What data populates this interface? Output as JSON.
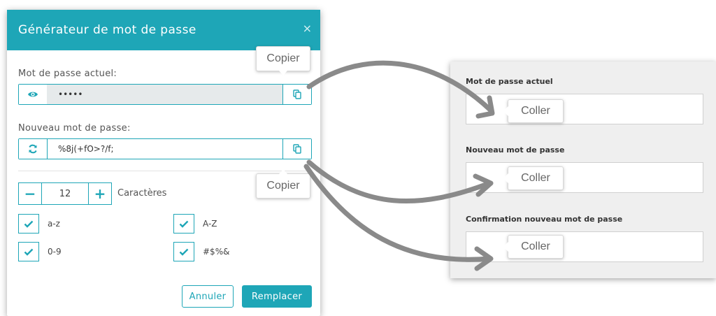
{
  "dialog": {
    "title": "Générateur de mot de passe",
    "close_glyph": "×",
    "current_label": "Mot de passe actuel:",
    "current_value": "•••••",
    "new_label": "Nouveau mot de passe:",
    "new_value": "%8j(+fO>?/f;",
    "length_value": "12",
    "length_minus": "−",
    "length_plus": "+",
    "length_label": "Caractères",
    "checks": [
      {
        "label": "a-z",
        "checked": true
      },
      {
        "label": "A-Z",
        "checked": true
      },
      {
        "label": "0-9",
        "checked": true
      },
      {
        "label": "#$%&",
        "checked": true
      }
    ],
    "cancel_label": "Annuler",
    "replace_label": "Remplacer",
    "accent_color": "#1ea6b7",
    "icons": {
      "reveal": "eye-icon",
      "regenerate": "refresh-icon",
      "copy": "copy-icon",
      "check": "check-icon"
    }
  },
  "tooltips": {
    "copy": "Copier",
    "paste": "Coller"
  },
  "target_form": {
    "current_label": "Mot de passe actuel",
    "new_label": "Nouveau mot de passe",
    "confirm_label": "Confirmation nouveau mot de passe"
  }
}
